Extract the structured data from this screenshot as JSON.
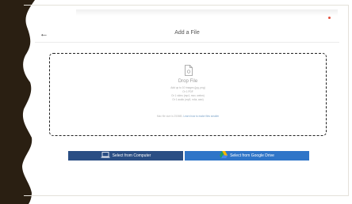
{
  "header": {
    "title": "Add a File",
    "back_icon": "arrow-left-icon"
  },
  "dropzone": {
    "title": "Drop File",
    "lines": [
      "Add up to 10 images (jpg, png)",
      "Or 1 PDF",
      "Or 1 video (mp4, mov, webm)",
      "Or 1 audio (mp3, m4a, wav)"
    ],
    "max_size_text": "Max file size is 250MB.",
    "help_link": "Learn how to make files smaller"
  },
  "buttons": {
    "computer": {
      "label": "Select from Computer",
      "icon": "laptop-icon",
      "color": "#2a4e84"
    },
    "drive": {
      "label": "Select from Google Drive",
      "icon": "google-drive-icon",
      "color": "#2f75c8"
    }
  },
  "colors": {
    "edge": "#2a1f12",
    "accent_red": "#e3513f"
  }
}
